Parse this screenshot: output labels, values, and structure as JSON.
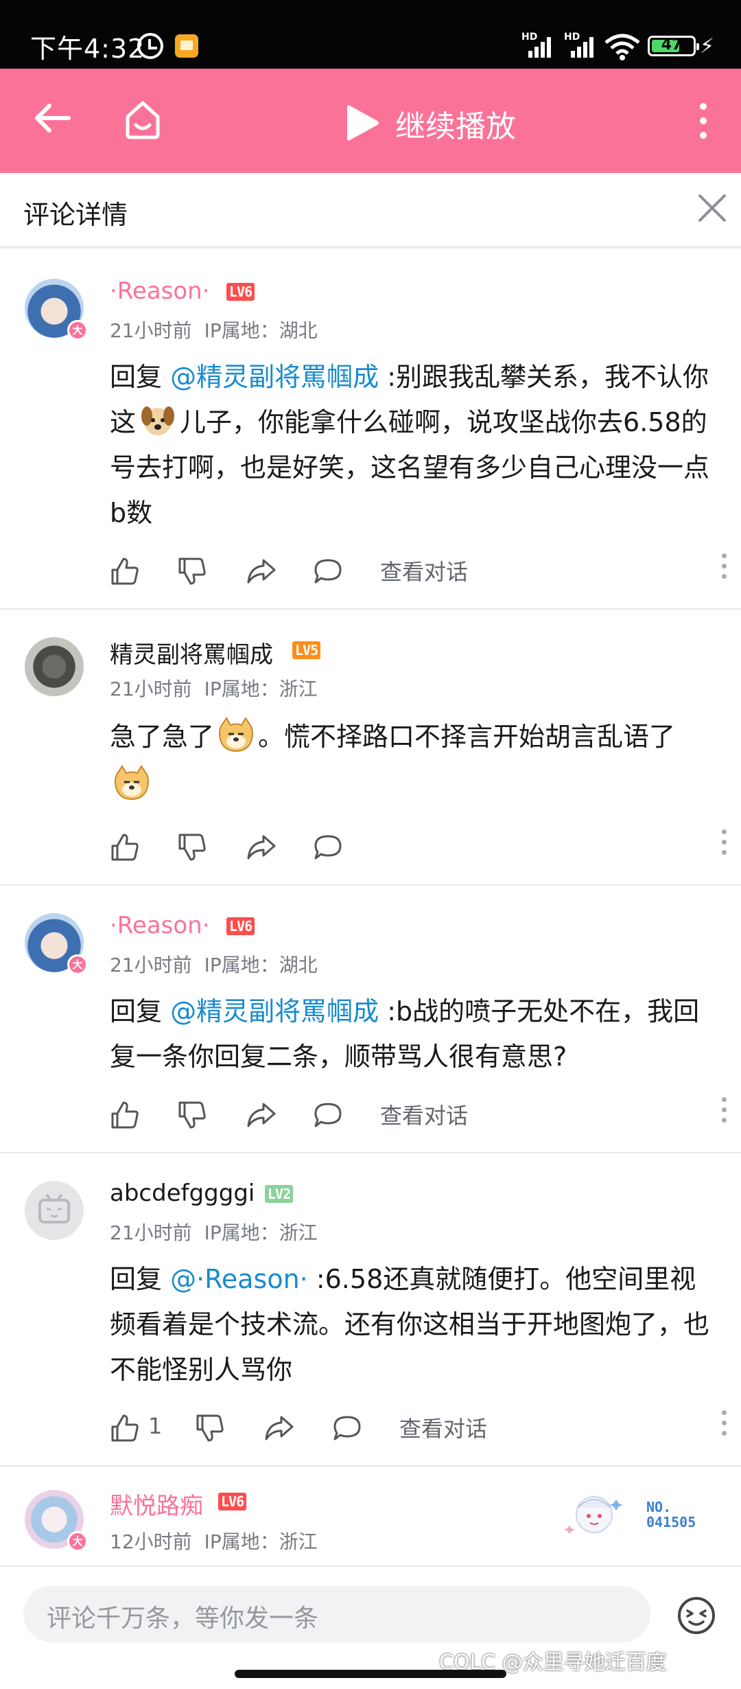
{
  "status_bar": {
    "time": "下午4:32",
    "battery": "47",
    "signal_label": "HD"
  },
  "header": {
    "title": "继续播放"
  },
  "detail": {
    "title": "评论详情"
  },
  "comments": [
    {
      "user": "·Reason·",
      "level": "LV6",
      "vip": true,
      "time": "21小时前",
      "ip": "IP属地：湖北",
      "prefix": "回复 ",
      "mention": "@精灵副将罵帼成",
      "text_a": " :别跟我乱攀关系，我不认你这",
      "text_b": "儿子，你能拿什么碰啊，说攻坚战你去6.58的号去打啊，也是好笑，这名望有多少自己心理没一点b数",
      "view_conv": "查看对话"
    },
    {
      "user": "精灵副将罵帼成",
      "level": "LV5",
      "vip": false,
      "time": "21小时前",
      "ip": "IP属地：浙江",
      "text_a": "急了急了",
      "text_b": "。慌不择路口不择言开始胡言乱语了"
    },
    {
      "user": "·Reason·",
      "level": "LV6",
      "vip": true,
      "time": "21小时前",
      "ip": "IP属地：湖北",
      "prefix": "回复 ",
      "mention": "@精灵副将罵帼成",
      "text": " :b战的喷子无处不在，我回复一条你回复二条，顺带骂人很有意思?",
      "view_conv": "查看对话"
    },
    {
      "user": "abcdefggggi",
      "level": "LV2",
      "vip": false,
      "time": "21小时前",
      "ip": "IP属地：浙江",
      "prefix": "回复 ",
      "mention": "@·Reason·",
      "text": " :6.58还真就随便打。他空间里视频看着是个技术流。还有你这相当于开地图炮了，也不能怪别人骂你",
      "likes": "1",
      "view_conv": "查看对话"
    },
    {
      "user": "默悦路痴",
      "level": "LV6",
      "vip": true,
      "time": "12小时前",
      "ip": "IP属地：浙江",
      "fan_badge_no": "NO.\n041505"
    }
  ],
  "input": {
    "placeholder": "评论千万条，等你发一条"
  },
  "watermark": "COLC @众里寻她迁百度",
  "colors": {
    "brand_pink": "#fb7299",
    "mention_blue": "#178bcf",
    "lv6": "#ff4c4c",
    "lv5": "#ff8c1a",
    "lv2": "#8bd29b"
  }
}
